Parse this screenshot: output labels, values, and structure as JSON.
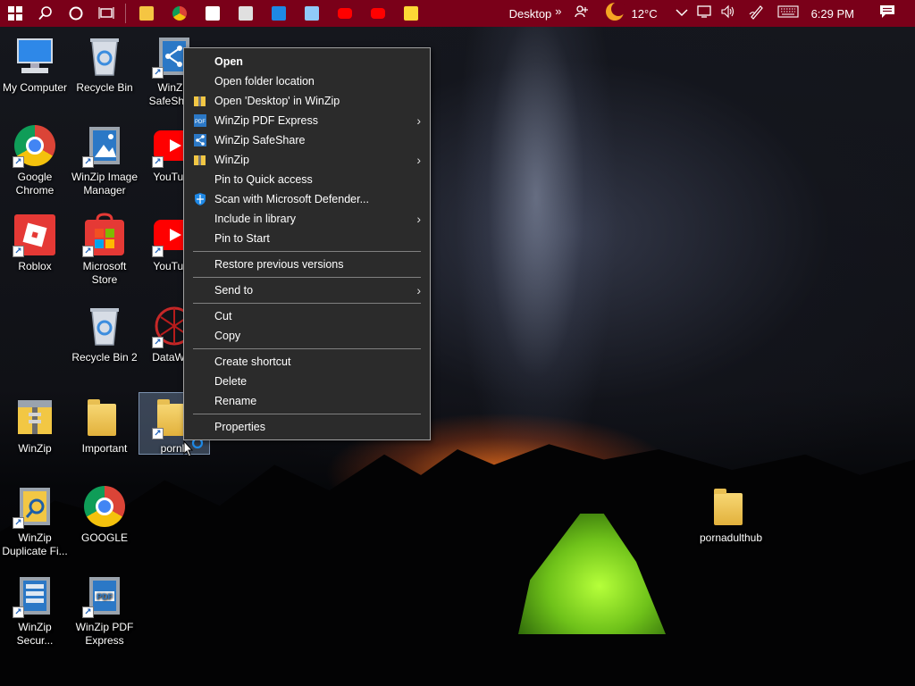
{
  "taskbar": {
    "apps": [
      {
        "name": "file-explorer",
        "color": "#f5c542"
      },
      {
        "name": "chrome",
        "color": "#4285f4"
      },
      {
        "name": "store",
        "color": "#ffffff"
      },
      {
        "name": "roblox",
        "color": "#e0e0e0"
      },
      {
        "name": "monitor",
        "color": "#1e88e5"
      },
      {
        "name": "image-manager",
        "color": "#90caf9"
      },
      {
        "name": "youtube-1",
        "color": "#ff0000"
      },
      {
        "name": "youtube-2",
        "color": "#ff0000"
      },
      {
        "name": "sticky-notes",
        "color": "#fdd835"
      }
    ],
    "toolbar_label": "Desktop",
    "toolbar_chevron": "»",
    "temperature": "12°C",
    "time": "6:29 PM"
  },
  "desktop": {
    "icons": [
      {
        "label": "My Computer"
      },
      {
        "label": "Recycle Bin"
      },
      {
        "label": "WinZip SafeShare"
      },
      {
        "label": "Google Chrome"
      },
      {
        "label": "WinZip Image Manager"
      },
      {
        "label": "YouTube"
      },
      {
        "label": "Roblox"
      },
      {
        "label": "Microsoft Store"
      },
      {
        "label": "YouTube"
      },
      {
        "label": "Recycle Bin 2"
      },
      {
        "label": "DataWag"
      },
      {
        "label": "WinZip"
      },
      {
        "label": "Important"
      },
      {
        "label": "pornh"
      },
      {
        "label": "WinZip Duplicate Fi..."
      },
      {
        "label": "GOOGLE"
      },
      {
        "label": "WinZip Secur..."
      },
      {
        "label": "WinZip PDF Express"
      },
      {
        "label": "pornadulthub"
      }
    ]
  },
  "context_menu": {
    "items": [
      {
        "label": "Open"
      },
      {
        "label": "Open folder location"
      },
      {
        "label": "Open 'Desktop' in WinZip"
      },
      {
        "label": "WinZip PDF Express"
      },
      {
        "label": "WinZip SafeShare"
      },
      {
        "label": "WinZip"
      },
      {
        "label": "Pin to Quick access"
      },
      {
        "label": "Scan with Microsoft Defender..."
      },
      {
        "label": "Include in library"
      },
      {
        "label": "Pin to Start"
      },
      {
        "label": "Restore previous versions"
      },
      {
        "label": "Send to"
      },
      {
        "label": "Cut"
      },
      {
        "label": "Copy"
      },
      {
        "label": "Create shortcut"
      },
      {
        "label": "Delete"
      },
      {
        "label": "Rename"
      },
      {
        "label": "Properties"
      }
    ],
    "submenu_arrow": "›"
  }
}
